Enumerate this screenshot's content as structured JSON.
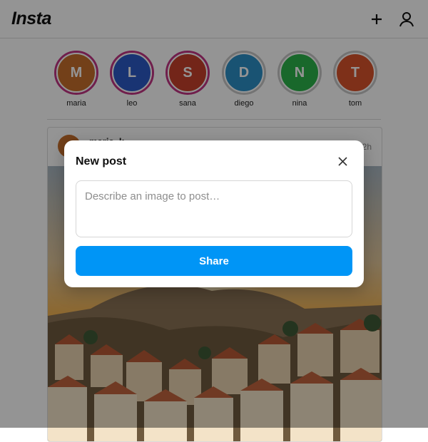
{
  "app": {
    "title": "Insta"
  },
  "header": {
    "icons": [
      "plus-icon",
      "user-icon"
    ]
  },
  "stories": [
    {
      "initial": "M",
      "name": "maria",
      "color": "#c76f2c",
      "ring": "#c13584"
    },
    {
      "initial": "L",
      "name": "leo",
      "color": "#2c5bc7",
      "ring": "#c13584"
    },
    {
      "initial": "S",
      "name": "sana",
      "color": "#c7402c",
      "ring": "#c13584"
    },
    {
      "initial": "D",
      "name": "diego",
      "color": "#2c8fc7",
      "ring": "#c7c7c7"
    },
    {
      "initial": "N",
      "name": "nina",
      "color": "#2cb34a",
      "ring": "#c7c7c7"
    },
    {
      "initial": "T",
      "name": "tom",
      "color": "#d9542c",
      "ring": "#c7c7c7"
    }
  ],
  "post": {
    "user": "maria_k",
    "time": "2h"
  },
  "modal": {
    "title": "New post",
    "placeholder": "Describe an image to post…",
    "share_label": "Share"
  },
  "colors": {
    "accent": "#0095f6"
  }
}
